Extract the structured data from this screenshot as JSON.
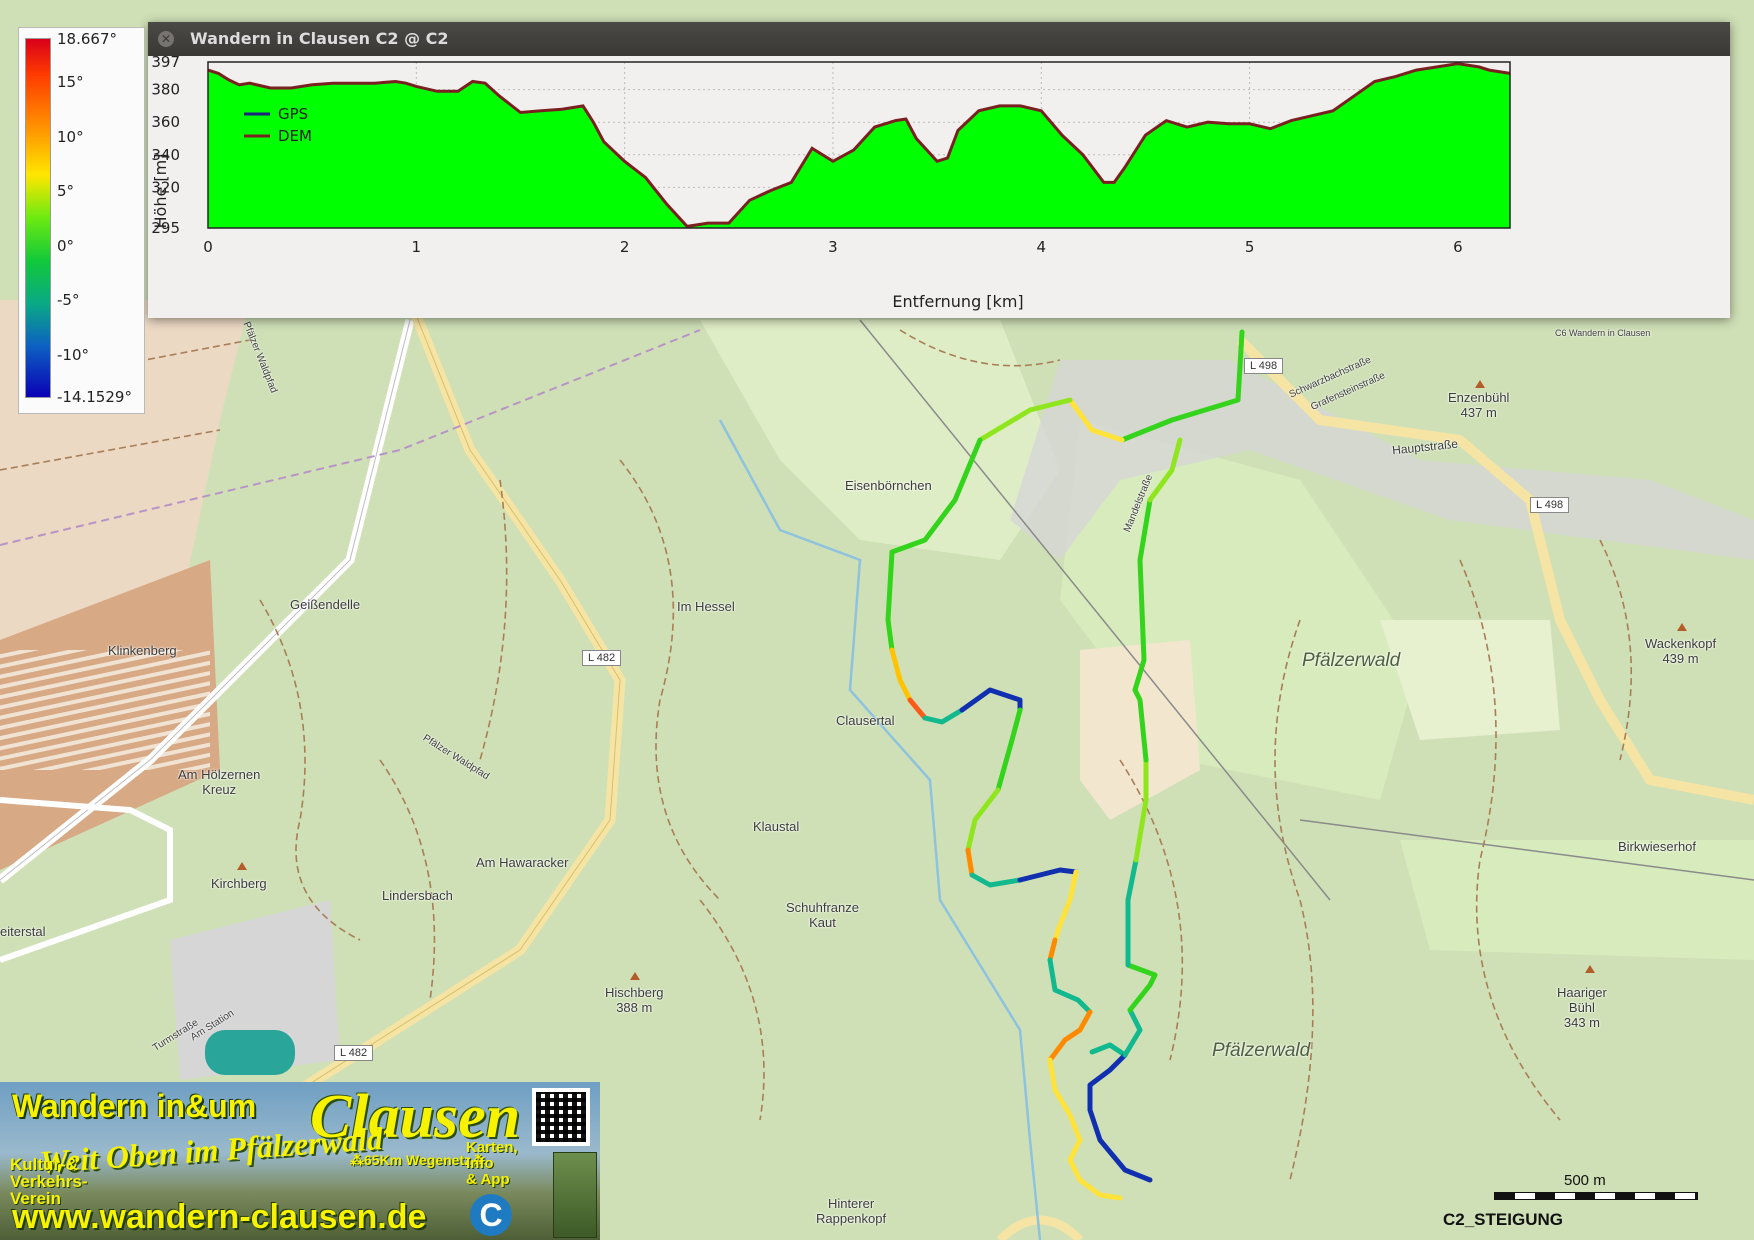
{
  "elevation_window": {
    "title": "Wandern in Clausen C2 @ C2",
    "legend": [
      {
        "name": "GPS",
        "color": "#1a237e"
      },
      {
        "name": "DEM",
        "color": "#7a2020"
      }
    ],
    "ylabel": "Höhe [m]",
    "xlabel": "Entfernung [km]",
    "y_ticks": [
      "397",
      "380",
      "360",
      "340",
      "320",
      "295"
    ],
    "x_ticks": [
      "0",
      "1",
      "2",
      "3",
      "4",
      "5",
      "6"
    ]
  },
  "chart_data": {
    "type": "area",
    "title": "Wandern in Clausen C2 @ C2",
    "xlabel": "Entfernung [km]",
    "ylabel": "Höhe [m]",
    "xlim": [
      0,
      6.25
    ],
    "ylim": [
      295,
      397
    ],
    "grid": true,
    "legend_position": "top-left",
    "fill_color": "#00ff00",
    "series": [
      {
        "name": "DEM",
        "x": [
          0,
          0.05,
          0.1,
          0.15,
          0.2,
          0.3,
          0.4,
          0.5,
          0.6,
          0.7,
          0.8,
          0.9,
          0.95,
          1.0,
          1.1,
          1.2,
          1.27,
          1.33,
          1.4,
          1.5,
          1.6,
          1.7,
          1.8,
          1.85,
          1.9,
          2.0,
          2.1,
          2.2,
          2.3,
          2.4,
          2.5,
          2.6,
          2.7,
          2.8,
          2.9,
          3.0,
          3.1,
          3.2,
          3.3,
          3.35,
          3.4,
          3.5,
          3.55,
          3.6,
          3.7,
          3.8,
          3.9,
          4.0,
          4.1,
          4.2,
          4.3,
          4.35,
          4.4,
          4.5,
          4.6,
          4.7,
          4.8,
          4.9,
          5.0,
          5.1,
          5.2,
          5.3,
          5.4,
          5.5,
          5.6,
          5.7,
          5.8,
          5.9,
          6.0,
          6.1,
          6.15,
          6.25
        ],
        "values": [
          392,
          390,
          386,
          383,
          384,
          381,
          381,
          383,
          384,
          384,
          384,
          385,
          384,
          382,
          379,
          379,
          385,
          384,
          376,
          366,
          367,
          368,
          370,
          360,
          348,
          336,
          326,
          310,
          296,
          298,
          298,
          312,
          318,
          323,
          344,
          336,
          343,
          357,
          361,
          362,
          350,
          336,
          338,
          355,
          367,
          370,
          370,
          367,
          352,
          340,
          323,
          323,
          332,
          352,
          361,
          357,
          360,
          359,
          359,
          356,
          361,
          364,
          367,
          376,
          385,
          388,
          392,
          394,
          396,
          394,
          392,
          390
        ]
      }
    ]
  },
  "color_scale": {
    "labels": [
      "18.667°",
      "15°",
      "10°",
      "5°",
      "0°",
      "-5°",
      "-10°",
      "-14.1529°"
    ]
  },
  "map": {
    "labels": {
      "eisenbornchen": "Eisenbörnchen",
      "geissendelle": "Geißendelle",
      "im_hessel": "Im Hessel",
      "klinkenberg": "Klinkenberg",
      "clausertal": "Clausertal",
      "am_holzernen_kreuz": "Am Hölzernen\nKreuz",
      "klaustal": "Klaustal",
      "am_hawaracker": "Am Hawaracker",
      "kirchberg": "Kirchberg",
      "lindersbach": "Lindersbach",
      "eiterstal": "eiterstal",
      "schuhfranze_kaut": "Schuhfranze\nKaut",
      "hischberg": "Hischberg\n388 m",
      "hinterer_rappenkopf": "Hinterer\nRappenkopf",
      "pfalzerwald_1": "Pfälzerwald",
      "pfalzerwald_2": "Pfälzerwald",
      "enzenbuhl": "Enzenbühl\n437 m",
      "wackenkopf": "Wackenkopf\n439 m",
      "birkwieserhof": "Birkwieserhof",
      "haariger_buhl": "Haariger\nBühl\n343 m",
      "hauptstrasse": "Hauptstraße",
      "schwarzbachstrasse": "Schwarzbachstraße",
      "grafensteinstrasse": "Grafensteinstraße",
      "mandelstrasse": "Mandelstraße",
      "pfaelzer_waldpfad_1": "Pfälzer Waldpfad",
      "pfaelzer_waldpfad_2": "Pfälzer Waldpfad",
      "turmstrasse": "Turmstraße",
      "am_station": "Am Station",
      "c6": "C6 Wandern in Clausen"
    },
    "roads": {
      "l482_a": "L 482",
      "l482_b": "L 482",
      "l498_a": "L 498",
      "l498_b": "L 498"
    },
    "scale_bar": "500 m",
    "layer_name": "C2_STEIGUNG"
  },
  "banner": {
    "title": "Wandern in&um",
    "brand": "Clausen",
    "motto": "Weit Oben im Pfälzerwald",
    "subtitle": "⁂65Km Wegenetz⁂",
    "org": "Kultur-&\nVerkehrs-\nVerein",
    "info": "Karten,\nInfo\n& App",
    "url": "www.wandern-clausen.de",
    "logo_letter": "C"
  }
}
